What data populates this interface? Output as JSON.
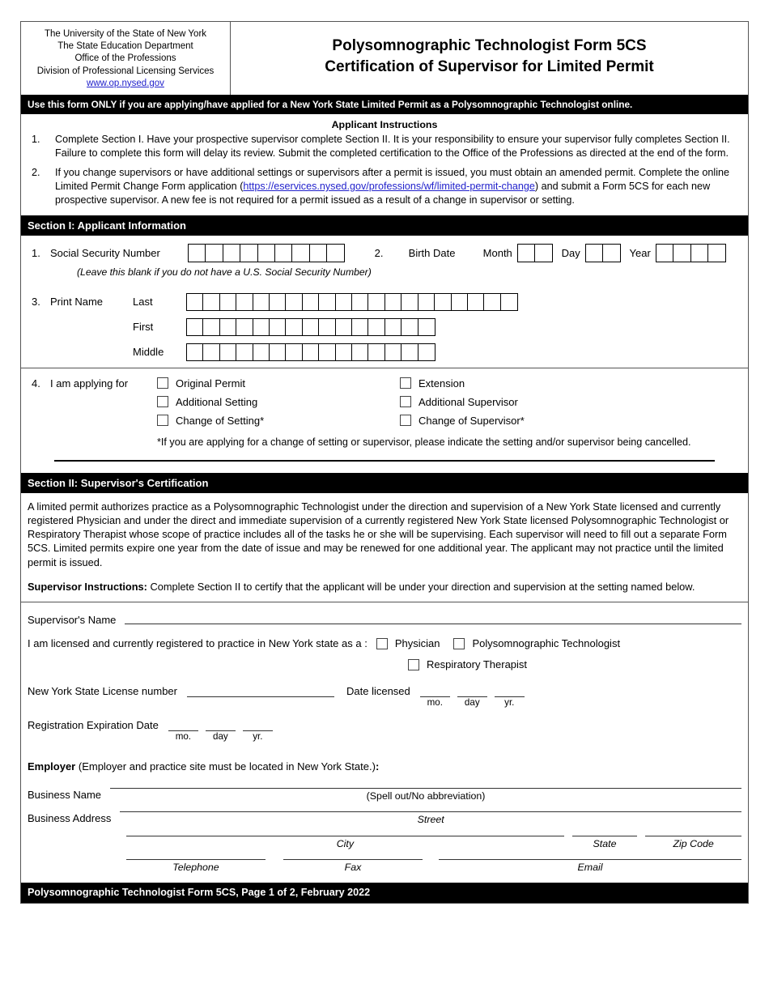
{
  "header": {
    "agency_lines": [
      "The University of the State of New York",
      "The State Education Department",
      "Office of the Professions",
      "Division of Professional Licensing Services"
    ],
    "website": "www.op.nysed.gov",
    "title_line1": "Polysomnographic Technologist Form 5CS",
    "title_line2": "Certification of Supervisor for Limited Permit"
  },
  "notice_bar": "Use this form ONLY if you are applying/have applied for a New York State Limited Permit as a Polysomnographic Technologist online.",
  "instructions": {
    "title": "Applicant Instructions",
    "items": [
      {
        "num": "1.",
        "text": "Complete Section I. Have your prospective supervisor complete Section II. It is your responsibility to ensure your supervisor fully completes Section II. Failure to complete this form will delay its review. Submit the completed certification to the Office of the Professions as directed at the end of the form."
      },
      {
        "num": "2.",
        "pre": "If you change supervisors or have additional settings or supervisors after a permit is issued, you must obtain an amended permit. Complete the online Limited Permit Change Form application (",
        "link": "https://eservices.nysed.gov/professions/wf/limited-permit-change",
        "post": ") and submit a Form 5CS for each new prospective supervisor. A new fee is not required for a permit issued as a result of a change in supervisor or setting."
      }
    ]
  },
  "section1": {
    "header": "Section I: Applicant Information",
    "q1_num": "1.",
    "q1_label": "Social Security Number",
    "ssn_boxes": 9,
    "ssn_note": "(Leave this blank if you do not have a U.S. Social Security Number)",
    "q2_num": "2.",
    "q2_label": "Birth Date",
    "month_label": "Month",
    "month_boxes": 2,
    "day_label": "Day",
    "day_boxes": 2,
    "year_label": "Year",
    "year_boxes": 4,
    "q3_num": "3.",
    "q3_label": "Print Name",
    "name_rows": [
      {
        "label": "Last",
        "boxes": 20
      },
      {
        "label": "First",
        "boxes": 15
      },
      {
        "label": "Middle",
        "boxes": 15
      }
    ],
    "q4_num": "4.",
    "q4_label": "I am applying for",
    "options_left": [
      "Original Permit",
      "Additional Setting",
      "Change of Setting*"
    ],
    "options_right": [
      "Extension",
      "Additional Supervisor",
      "Change of Supervisor*"
    ],
    "footnote": "*If you are applying for a change of setting or supervisor, please indicate the setting and/or supervisor being cancelled."
  },
  "section2": {
    "header": "Section II: Supervisor's Certification",
    "paragraph": "A limited permit authorizes practice as a Polysomnographic Technologist under the direction and supervision of a New York State licensed and currently registered Physician and under the direct and immediate supervision of a currently registered New York State licensed Polysomnographic Technologist or Respiratory Therapist whose scope of practice includes all of the tasks he or she will be supervising. Each supervisor will need to fill out a separate Form 5CS. Limited permits expire one year from the date of issue and may be renewed for one additional year. The applicant may not practice until the limited permit is issued.",
    "supervisor_instructions_label": "Supervisor Instructions:",
    "supervisor_instructions_text": " Complete Section II to certify that the applicant will be under your direction and supervision at the setting named below.",
    "supervisor_name_label": "Supervisor's Name",
    "licensed_label": "I am licensed and currently registered to practice in New York state as a :",
    "license_types": [
      "Physician",
      "Polysomnographic Technologist",
      "Respiratory Therapist"
    ],
    "license_number_label": "New York State License number",
    "date_licensed_label": "Date licensed",
    "date_parts": [
      "mo.",
      "day",
      "yr."
    ],
    "reg_expiration_label": "Registration Expiration Date",
    "reg_date_parts": [
      "mo.",
      "day",
      "yr."
    ],
    "employer_label": "Employer",
    "employer_note": " (Employer and practice site must be located in New York State.)",
    "employer_colon": ":",
    "business_name_label": "Business Name",
    "business_name_caption": "(Spell out/No abbreviation)",
    "business_address_label": "Business Address",
    "street_caption": "Street",
    "city_caption": "City",
    "state_caption": "State",
    "zip_caption": "Zip Code",
    "telephone_caption": "Telephone",
    "fax_caption": "Fax",
    "email_caption": "Email"
  },
  "footer": "Polysomnographic Technologist Form 5CS, Page 1 of 2,  February 2022"
}
